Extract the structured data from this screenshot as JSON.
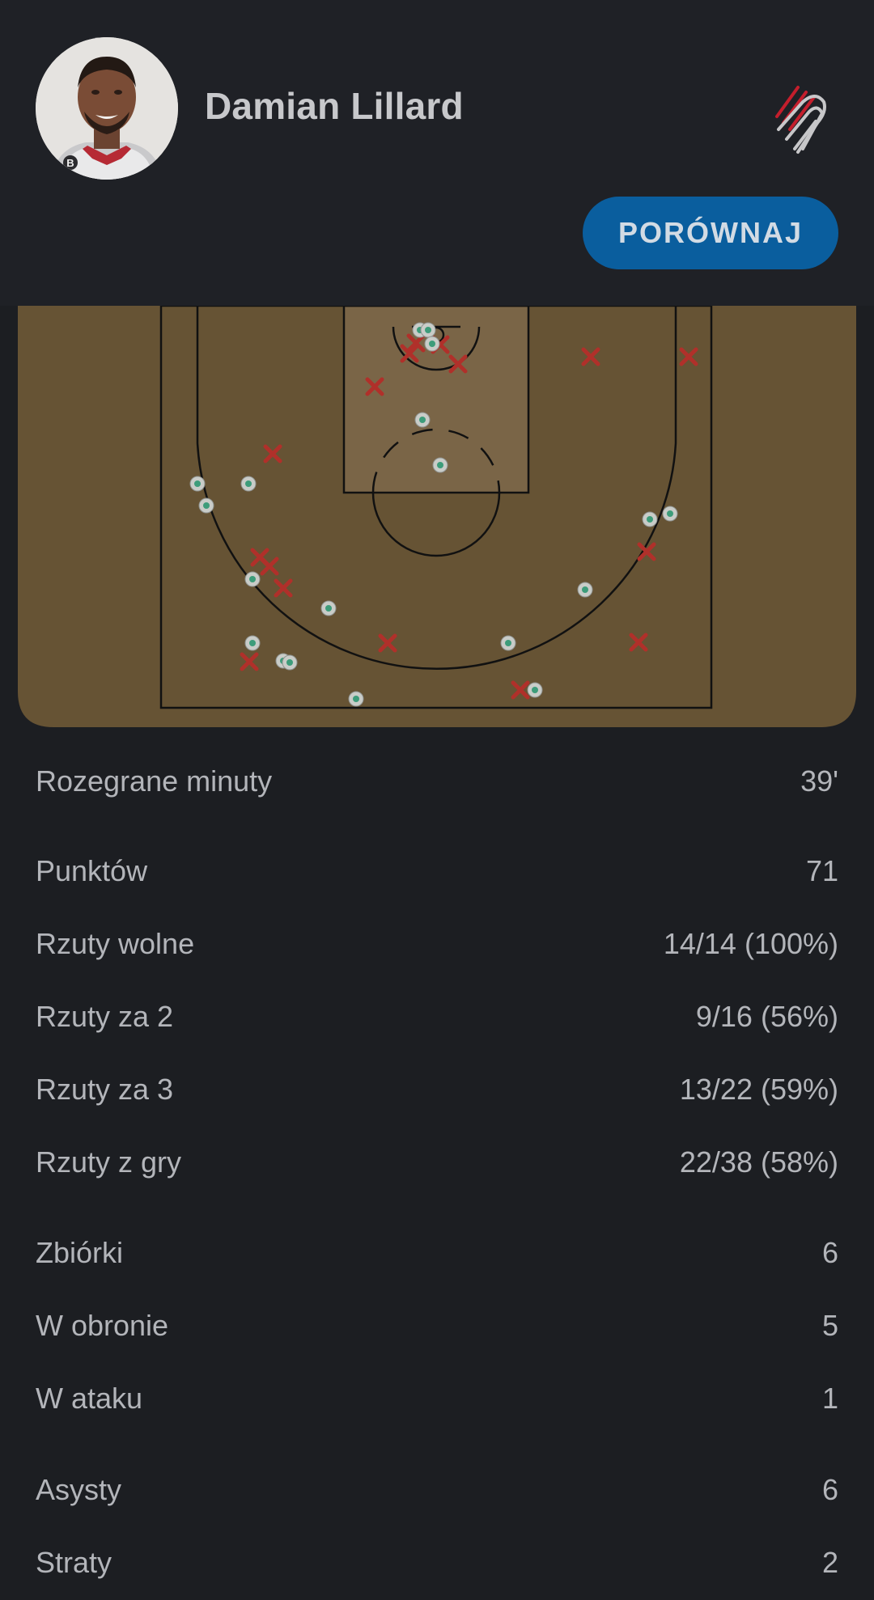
{
  "player": {
    "name": "Damian Lillard",
    "jersey_badge": "B"
  },
  "team": {
    "logo_icon": "trail-blazers-logo-icon"
  },
  "compare_button": {
    "label": "PORÓWNAJ"
  },
  "colors": {
    "court": "#665334",
    "paint": "#7a6547",
    "made": "#3d9c7a",
    "missed": "#b0302a",
    "button": "#0a5e9e"
  },
  "shot_chart": {
    "made_marker": "made-shot-icon",
    "missed_marker": "missed-shot-icon"
  },
  "stats": [
    {
      "label": "Rozegrane minuty",
      "value": "39'"
    },
    {
      "label": "Punktów",
      "value": "71"
    },
    {
      "label": "Rzuty wolne",
      "value": "14/14 (100%)"
    },
    {
      "label": "Rzuty za 2",
      "value": "9/16 (56%)"
    },
    {
      "label": "Rzuty za 3",
      "value": "13/22 (59%)"
    },
    {
      "label": "Rzuty z gry",
      "value": "22/38 (58%)"
    },
    {
      "label": "Zbiórki",
      "value": "6"
    },
    {
      "label": "W obronie",
      "value": "5"
    },
    {
      "label": "W ataku",
      "value": "1"
    },
    {
      "label": "Asysty",
      "value": "6"
    },
    {
      "label": "Straty",
      "value": "2"
    }
  ]
}
